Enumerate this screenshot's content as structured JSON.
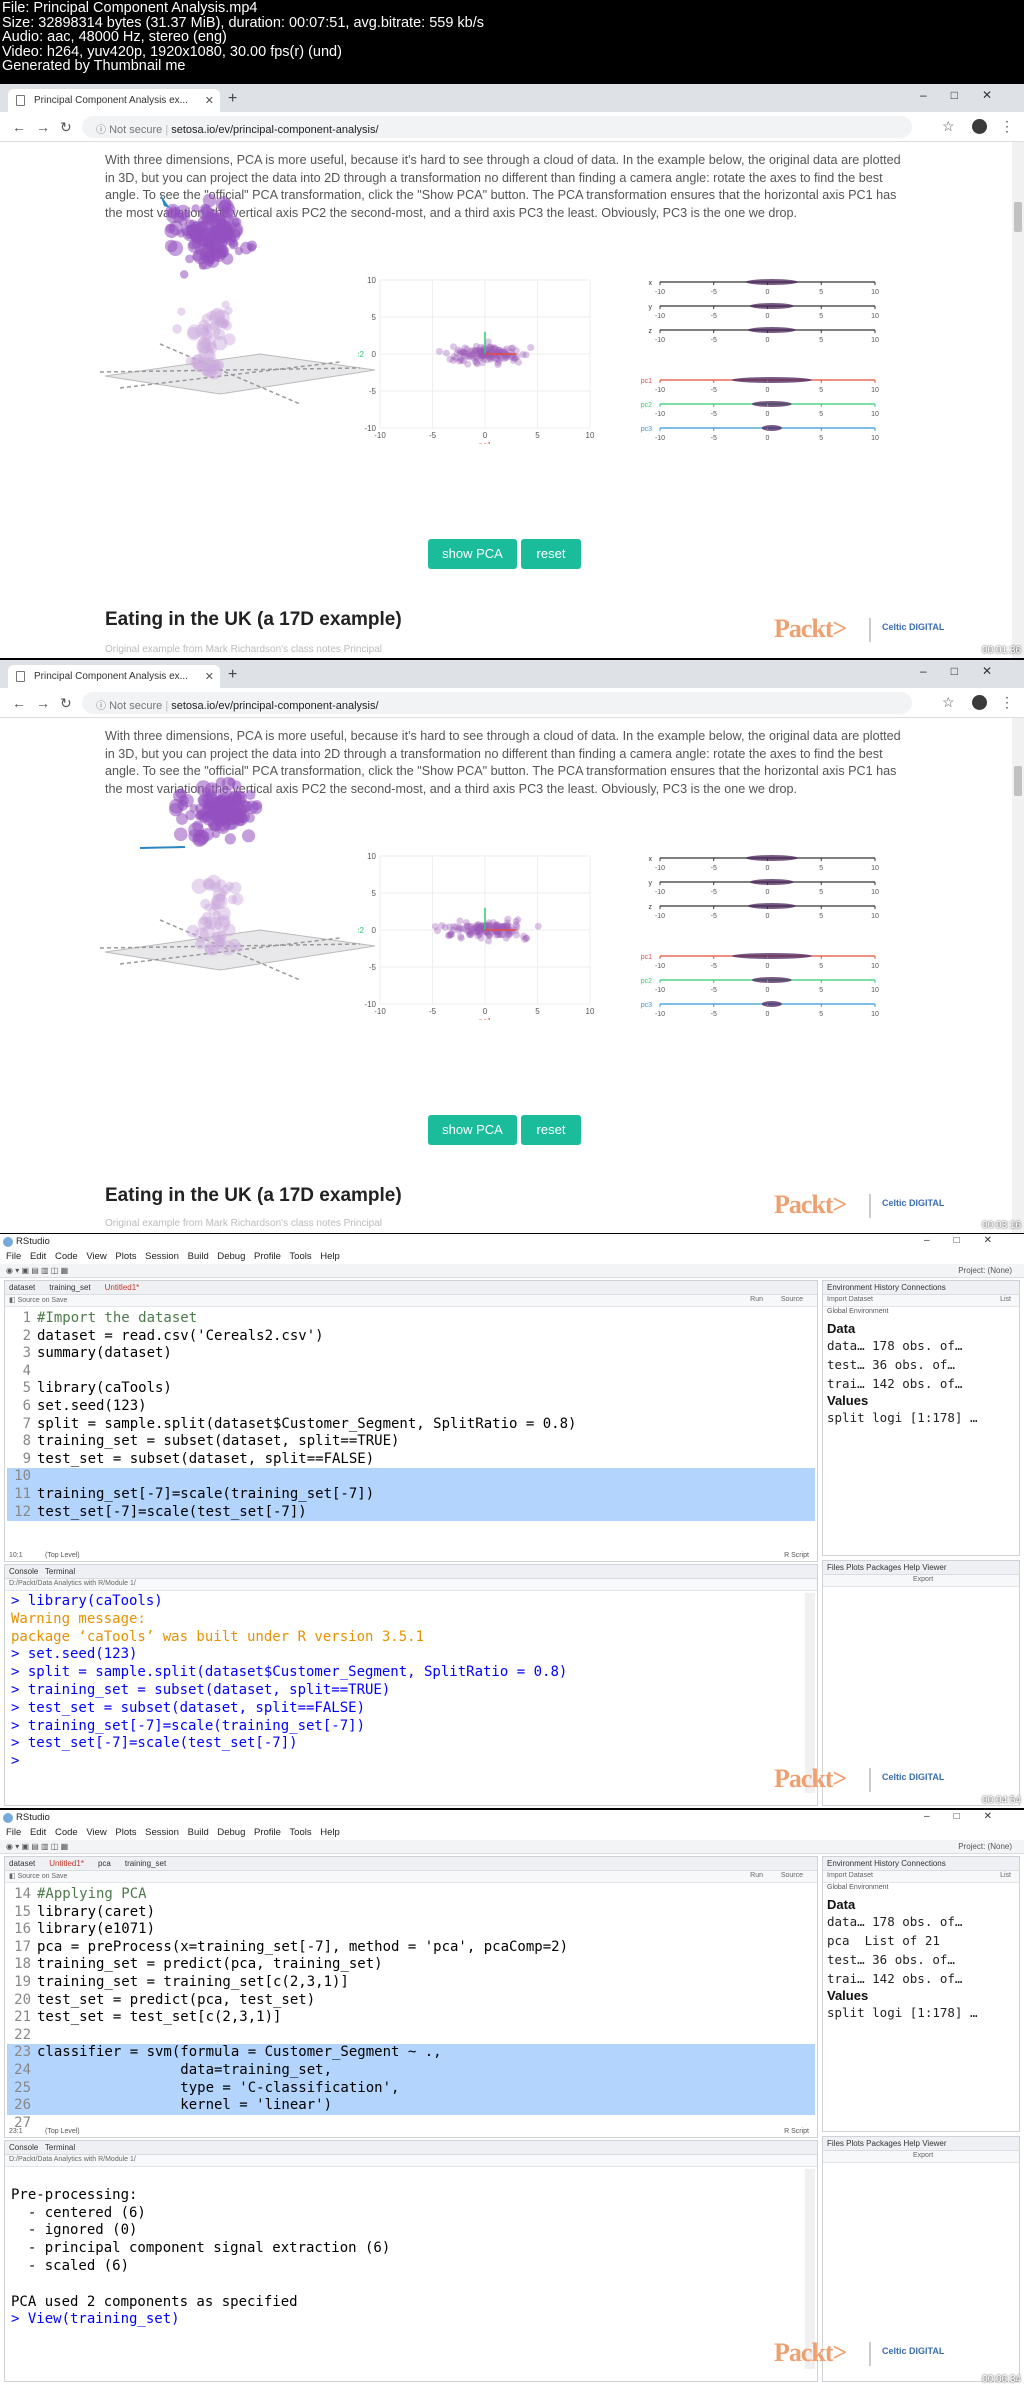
{
  "video_info": [
    "File: Principal Component Analysis.mp4",
    "Size: 32898314 bytes (31.37 MiB), duration: 00:07:51, avg.bitrate: 559 kb/s",
    "Audio: aac, 48000 Hz, stereo (eng)",
    "Video: h264, yuv420p, 1920x1080, 30.00 fps(r) (und)",
    "Generated by Thumbnail me"
  ],
  "browser": {
    "tab_title": "Principal Component Analysis ex...",
    "url_prefix": "Not secure",
    "url_sep": "|",
    "url_host": "setosa.io/ev/principal-component-analysis/"
  },
  "article": {
    "paragraph": "With three dimensions, PCA is more useful, because it's hard to see through a cloud of data. In the example below, the original data are plotted in 3D, but you can project the data into 2D through a transformation no different than finding a camera angle: rotate the axes to find the best angle. To see the \"official\" PCA transformation, click the \"Show PCA\" button. The PCA transformation ensures that the horizontal axis PC1 has the most variation, the vertical axis PC2 the second-most, and a third axis PC3 the least. Obviously, PC3 is the one we drop.",
    "show_pca": "show PCA",
    "reset": "reset",
    "heading": "Eating in the UK (a 17D example)",
    "subtext": "Original example from Mark Richardson's class notes Principal"
  },
  "plot2d": {
    "ylabel": "pc2",
    "xlabel": "pc1",
    "yticks": [
      "10",
      "5",
      "0",
      "-5",
      "-10"
    ],
    "xticks": [
      "-10",
      "-5",
      "0",
      "5",
      "10"
    ]
  },
  "axes1d": {
    "labels": [
      "x",
      "y",
      "z",
      "pc1",
      "pc2",
      "pc3"
    ],
    "ticks": [
      "-10",
      "-5",
      "0",
      "5",
      "10"
    ]
  },
  "branding": {
    "packt": "Packt>",
    "cd": "Celtic DIGITAL",
    "timestamps": [
      "00:01:36",
      "00:03:16",
      "00:04:54",
      "00:06:34"
    ]
  },
  "rstudio": {
    "title": "RStudio",
    "menu": [
      "File",
      "Edit",
      "Code",
      "View",
      "Plots",
      "Session",
      "Build",
      "Debug",
      "Profile",
      "Tools",
      "Help"
    ],
    "project": "Project: (None)",
    "tabs_a": [
      "dataset",
      "training_set",
      "Untitled1*"
    ],
    "tabs_b": [
      "dataset",
      "Untitled1*",
      "pca",
      "training_set"
    ],
    "editor_tool": "Source on Save",
    "run": "Run",
    "source": "Source",
    "status_a": "10:1",
    "status_b": "23:1",
    "toplevel": "(Top Level)",
    "rscript": "R Script",
    "console_tabs": [
      "Console",
      "Terminal"
    ],
    "console_path": "D:/Packt/Data Analytics with R/Module 1/",
    "env_tabs": [
      "Environment",
      "History",
      "Connections"
    ],
    "env_tool": "Import Dataset",
    "global_env": "Global Environment",
    "list": "List",
    "files_tabs": [
      "Files",
      "Plots",
      "Packages",
      "Help",
      "Viewer"
    ],
    "export": "Export",
    "data_hdr": "Data",
    "values_hdr": "Values",
    "env_a": [
      "data… 178 obs. of…",
      "test… 36 obs. of…",
      "trai… 142 obs. of…"
    ],
    "env_b": [
      "data… 178 obs. of…",
      "pca  List of 21",
      "test… 36 obs. of…",
      "trai… 142 obs. of…"
    ],
    "split_row": "split logi [1:178] …",
    "code_a": [
      "#Import the dataset",
      "dataset = read.csv('Cereals2.csv')",
      "summary(dataset)",
      "",
      "library(caTools)",
      "set.seed(123)",
      "split = sample.split(dataset$Customer_Segment, SplitRatio = 0.8)",
      "training_set = subset(dataset, split==TRUE)",
      "test_set = subset(dataset, split==FALSE)",
      "",
      "training_set[-7]=scale(training_set[-7])",
      "test_set[-7]=scale(test_set[-7])"
    ],
    "console_a": [
      "> library(caTools)",
      "Warning message:",
      "package ‘caTools’ was built under R version 3.5.1",
      "> set.seed(123)",
      "> split = sample.split(dataset$Customer_Segment, SplitRatio = 0.8)",
      "> training_set = subset(dataset, split==TRUE)",
      "> test_set = subset(dataset, split==FALSE)",
      "> training_set[-7]=scale(training_set[-7])",
      "> test_set[-7]=scale(test_set[-7])",
      ">"
    ],
    "code_b_start": 14,
    "code_b": [
      "#Applying PCA",
      "library(caret)",
      "library(e1071)",
      "pca = preProcess(x=training_set[-7], method = 'pca', pcaComp=2)",
      "training_set = predict(pca, training_set)",
      "training_set = training_set[c(2,3,1)]",
      "test_set = predict(pca, test_set)",
      "test_set = test_set[c(2,3,1)]",
      "",
      "classifier = svm(formula = Customer_Segment ~ .,",
      "                 data=training_set,",
      "                 type = 'C-classification',",
      "                 kernel = 'linear')",
      ""
    ],
    "console_b": [
      "",
      "Pre-processing:",
      "  - centered (6)",
      "  - ignored (0)",
      "  - principal component signal extraction (6)",
      "  - scaled (6)",
      "",
      "PCA used 2 components as specified",
      "> View(training_set)"
    ]
  },
  "colors": {
    "accent": "#1abc9c",
    "selection": "#b3d4fc",
    "prompt": "#0000ff",
    "warning": "#e69100",
    "packt": "#f0a070"
  }
}
